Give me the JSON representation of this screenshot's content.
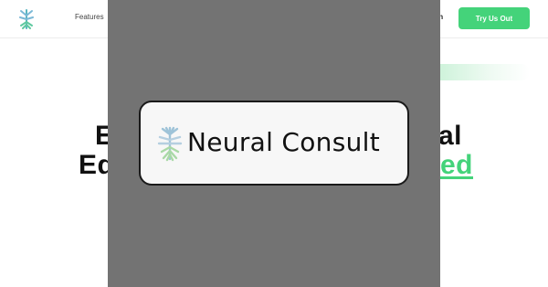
{
  "nav": {
    "links": [
      "Features"
    ],
    "login_label": "In",
    "cta_label": "Try Us Out",
    "logo_icon": "neural-tree-logo-icon"
  },
  "hero": {
    "line1_left": "E",
    "line2_left": "Ed",
    "line1_right": "al",
    "line2_right": "ed"
  },
  "splash": {
    "brand_name": "Neural Consult",
    "logo_icon": "neural-tree-logo-icon"
  },
  "colors": {
    "accent": "#44d37a",
    "overlay": "#737373",
    "card_bg": "#f7f7f7",
    "logo_blue": "#9ec3d8",
    "logo_green": "#a9d9a6"
  }
}
